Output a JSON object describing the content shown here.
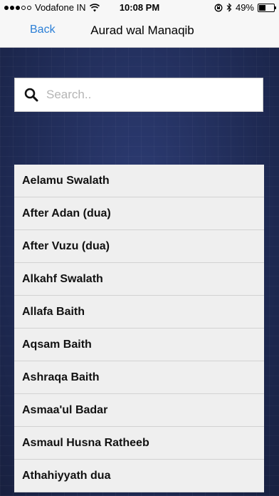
{
  "status_bar": {
    "carrier": "Vodafone IN",
    "time": "10:08 PM",
    "battery_percent": "49%",
    "battery_level": 0.49,
    "signal_bars_filled": 3,
    "signal_bars_total": 5,
    "icons": [
      "wifi-icon",
      "rotation-lock-icon",
      "bluetooth-icon",
      "battery-icon"
    ]
  },
  "nav": {
    "back_label": "Back",
    "title": "Aurad wal Manaqib"
  },
  "search": {
    "placeholder": "Search..",
    "value": "",
    "icon": "search-icon"
  },
  "list": {
    "items": [
      {
        "label": "Aelamu Swalath"
      },
      {
        "label": "After Adan (dua)"
      },
      {
        "label": "After Vuzu (dua)"
      },
      {
        "label": "Alkahf Swalath"
      },
      {
        "label": "Allafa Baith"
      },
      {
        "label": "Aqsam Baith"
      },
      {
        "label": "Ashraqa Baith"
      },
      {
        "label": "Asmaa'ul Badar"
      },
      {
        "label": "Asmaul Husna Ratheeb"
      },
      {
        "label": "Athahiyyath dua"
      }
    ]
  },
  "colors": {
    "accent": "#2b7fd6",
    "background": "#1f2a55",
    "list_bg": "#efefef"
  }
}
